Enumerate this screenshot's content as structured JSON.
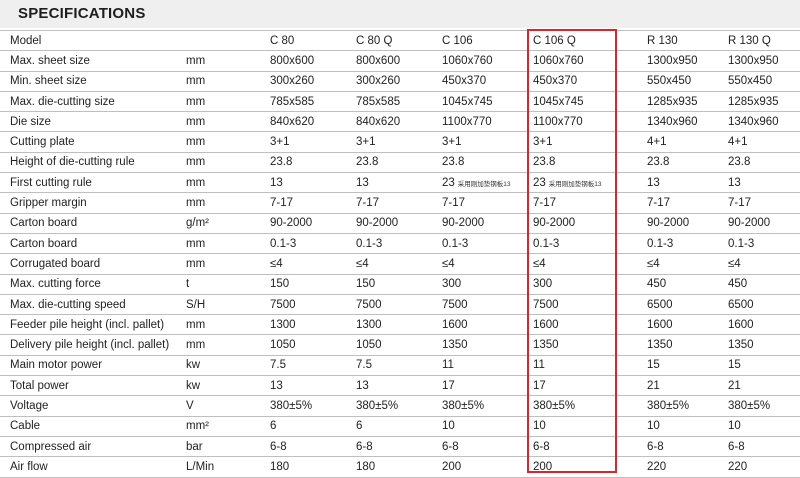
{
  "title": "SPECIFICATIONS",
  "header": [
    "Model",
    "",
    "C 80",
    "C 80 Q",
    "C 106",
    "C 106 Q",
    "R 130",
    "R 130 Q"
  ],
  "rows": [
    {
      "param": "Max. sheet size",
      "unit": "mm",
      "values": [
        "800x600",
        "800x600",
        "1060x760",
        "1060x760",
        "1300x950",
        "1300x950"
      ]
    },
    {
      "param": "Min. sheet size",
      "unit": "mm",
      "values": [
        "300x260",
        "300x260",
        "450x370",
        "450x370",
        "550x450",
        "550x450"
      ]
    },
    {
      "param": "Max. die-cutting size",
      "unit": "mm",
      "values": [
        "785x585",
        "785x585",
        "1045x745",
        "1045x745",
        "1285x935",
        "1285x935"
      ]
    },
    {
      "param": "Die size",
      "unit": "mm",
      "values": [
        "840x620",
        "840x620",
        "1100x770",
        "1100x770",
        "1340x960",
        "1340x960"
      ]
    },
    {
      "param": "Cutting plate",
      "unit": "mm",
      "values": [
        "3+1",
        "3+1",
        "3+1",
        "3+1",
        "4+1",
        "4+1"
      ]
    },
    {
      "param": "Height of die-cutting rule",
      "unit": "mm",
      "values": [
        "23.8",
        "23.8",
        "23.8",
        "23.8",
        "23.8",
        "23.8"
      ]
    },
    {
      "param": "First cutting rule",
      "unit": "mm",
      "values": [
        "13",
        "13",
        "23",
        "23",
        "13",
        "13"
      ],
      "notes": [
        "",
        "",
        "采用刚加垫钢板13",
        "采用刚加垫钢板13",
        "",
        ""
      ]
    },
    {
      "param": "Gripper margin",
      "unit": "mm",
      "values": [
        "7-17",
        "7-17",
        "7-17",
        "7-17",
        "7-17",
        "7-17"
      ]
    },
    {
      "param": "Carton board",
      "unit": "g/m²",
      "values": [
        "90-2000",
        "90-2000",
        "90-2000",
        "90-2000",
        "90-2000",
        "90-2000"
      ]
    },
    {
      "param": "Carton board",
      "unit": "mm",
      "values": [
        "0.1-3",
        "0.1-3",
        "0.1-3",
        "0.1-3",
        "0.1-3",
        "0.1-3"
      ]
    },
    {
      "param": "Corrugated board",
      "unit": "mm",
      "values": [
        "≤4",
        "≤4",
        "≤4",
        "≤4",
        "≤4",
        "≤4"
      ]
    },
    {
      "param": "Max. cutting force",
      "unit": "t",
      "values": [
        "150",
        "150",
        "300",
        "300",
        "450",
        "450"
      ]
    },
    {
      "param": "Max. die-cutting speed",
      "unit": "S/H",
      "values": [
        "7500",
        "7500",
        "7500",
        "7500",
        "6500",
        "6500"
      ]
    },
    {
      "param": "Feeder pile height (incl. pallet)",
      "unit": "mm",
      "values": [
        "1300",
        "1300",
        "1600",
        "1600",
        "1600",
        "1600"
      ]
    },
    {
      "param": "Delivery pile height (incl. pallet)",
      "unit": "mm",
      "values": [
        "1050",
        "1050",
        "1350",
        "1350",
        "1350",
        "1350"
      ]
    },
    {
      "param": "Main motor power",
      "unit": "kw",
      "values": [
        "7.5",
        "7.5",
        "11",
        "11",
        "15",
        "15"
      ]
    },
    {
      "param": "Total power",
      "unit": "kw",
      "values": [
        "13",
        "13",
        "17",
        "17",
        "21",
        "21"
      ]
    },
    {
      "param": "Voltage",
      "unit": "V",
      "values": [
        "380±5%",
        "380±5%",
        "380±5%",
        "380±5%",
        "380±5%",
        "380±5%"
      ]
    },
    {
      "param": "Cable",
      "unit": "mm²",
      "values": [
        "6",
        "6",
        "10",
        "10",
        "10",
        "10"
      ]
    },
    {
      "param": "Compressed air",
      "unit": "bar",
      "values": [
        "6-8",
        "6-8",
        "6-8",
        "6-8",
        "6-8",
        "6-8"
      ]
    },
    {
      "param": "Air flow",
      "unit": "L/Min",
      "values": [
        "180",
        "180",
        "200",
        "200",
        "220",
        "220"
      ]
    }
  ],
  "highlight": {
    "column": "C 106 Q",
    "color": "#d9262b"
  }
}
